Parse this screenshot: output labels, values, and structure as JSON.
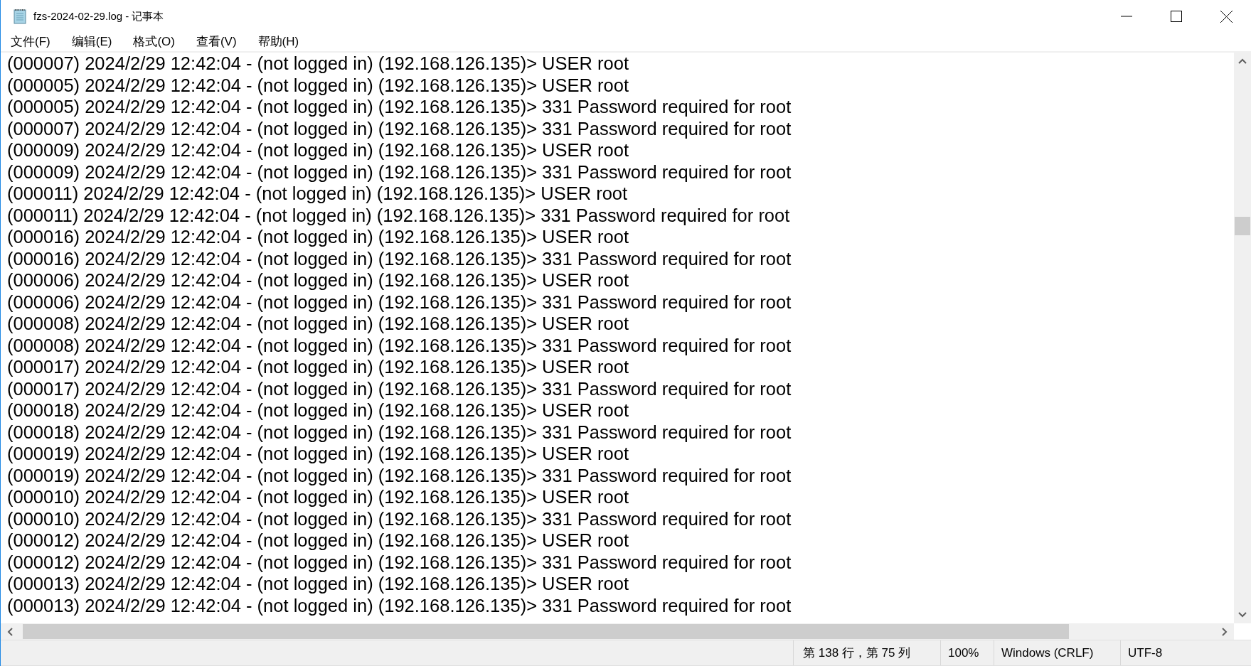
{
  "window": {
    "title": "fzs-2024-02-29.log - 记事本"
  },
  "menu": [
    "文件(F)",
    "编辑(E)",
    "格式(O)",
    "查看(V)",
    "帮助(H)"
  ],
  "lines": [
    "(000007) 2024/2/29 12:42:04 - (not logged in) (192.168.126.135)> USER root",
    "(000005) 2024/2/29 12:42:04 - (not logged in) (192.168.126.135)> USER root",
    "(000005) 2024/2/29 12:42:04 - (not logged in) (192.168.126.135)> 331 Password required for root",
    "(000007) 2024/2/29 12:42:04 - (not logged in) (192.168.126.135)> 331 Password required for root",
    "(000009) 2024/2/29 12:42:04 - (not logged in) (192.168.126.135)> USER root",
    "(000009) 2024/2/29 12:42:04 - (not logged in) (192.168.126.135)> 331 Password required for root",
    "(000011) 2024/2/29 12:42:04 - (not logged in) (192.168.126.135)> USER root",
    "(000011) 2024/2/29 12:42:04 - (not logged in) (192.168.126.135)> 331 Password required for root",
    "(000016) 2024/2/29 12:42:04 - (not logged in) (192.168.126.135)> USER root",
    "(000016) 2024/2/29 12:42:04 - (not logged in) (192.168.126.135)> 331 Password required for root",
    "(000006) 2024/2/29 12:42:04 - (not logged in) (192.168.126.135)> USER root",
    "(000006) 2024/2/29 12:42:04 - (not logged in) (192.168.126.135)> 331 Password required for root",
    "(000008) 2024/2/29 12:42:04 - (not logged in) (192.168.126.135)> USER root",
    "(000008) 2024/2/29 12:42:04 - (not logged in) (192.168.126.135)> 331 Password required for root",
    "(000017) 2024/2/29 12:42:04 - (not logged in) (192.168.126.135)> USER root",
    "(000017) 2024/2/29 12:42:04 - (not logged in) (192.168.126.135)> 331 Password required for root",
    "(000018) 2024/2/29 12:42:04 - (not logged in) (192.168.126.135)> USER root",
    "(000018) 2024/2/29 12:42:04 - (not logged in) (192.168.126.135)> 331 Password required for root",
    "(000019) 2024/2/29 12:42:04 - (not logged in) (192.168.126.135)> USER root",
    "(000019) 2024/2/29 12:42:04 - (not logged in) (192.168.126.135)> 331 Password required for root",
    "(000010) 2024/2/29 12:42:04 - (not logged in) (192.168.126.135)> USER root",
    "(000010) 2024/2/29 12:42:04 - (not logged in) (192.168.126.135)> 331 Password required for root",
    "(000012) 2024/2/29 12:42:04 - (not logged in) (192.168.126.135)> USER root",
    "(000012) 2024/2/29 12:42:04 - (not logged in) (192.168.126.135)> 331 Password required for root",
    "(000013) 2024/2/29 12:42:04 - (not logged in) (192.168.126.135)> USER root",
    "(000013) 2024/2/29 12:42:04 - (not logged in) (192.168.126.135)> 331 Password required for root"
  ],
  "status_bar": {
    "position": "第 138 行，第 75 列",
    "zoom": "100%",
    "line_ending": "Windows (CRLF)",
    "encoding": "UTF-8"
  }
}
